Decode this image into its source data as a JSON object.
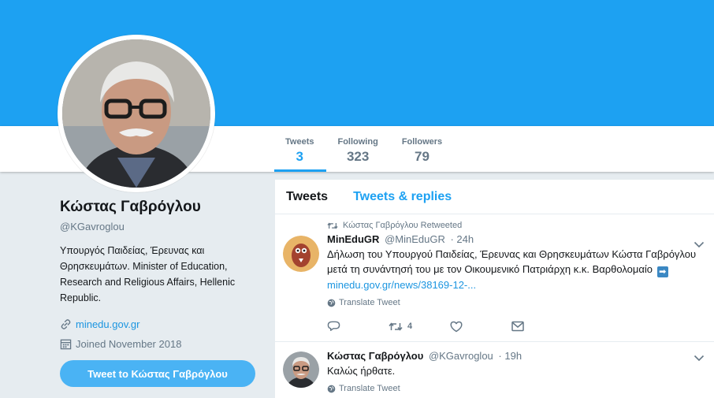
{
  "profile": {
    "name": "Κώστας Γαβρόγλου",
    "handle": "@KGavroglou",
    "bio": "Υπουργός Παιδείας, Έρευνας και Θρησκευμάτων. Minister of Education, Research and Religious Affairs, Hellenic Republic.",
    "website": "minedu.gov.gr",
    "joined": "Joined November 2018",
    "tweet_to_label": "Tweet to Κώστας Γαβρόγλου"
  },
  "stats": [
    {
      "label": "Tweets",
      "value": "3"
    },
    {
      "label": "Following",
      "value": "323"
    },
    {
      "label": "Followers",
      "value": "79"
    }
  ],
  "timeline": {
    "tabs": [
      "Tweets",
      "Tweets & replies"
    ],
    "tweets": [
      {
        "context": "Κώστας Γαβρόγλου Retweeted",
        "name": "MinEduGR",
        "handle": "@MinEduGR",
        "time": "· 24h",
        "text": "Δήλωση του Υπουργού Παιδείας, Έρευνας και Θρησκευμάτων Κώστα Γαβρόγλου μετά τη συνάντησή του με τον Οικουμενικό Πατριάρχη κ.κ. Βαρθολομαίο",
        "arrow": "➡",
        "link": "minedu.gov.gr/news/38169-12-...",
        "translate": "Translate Tweet",
        "retweets": "4"
      },
      {
        "name": "Κώστας Γαβρόγλου",
        "handle": "@KGavroglou",
        "time": "· 19h",
        "text": "Καλώς ήρθατε.",
        "translate": "Translate Tweet"
      }
    ]
  },
  "colors": {
    "brand": "#1da1f2",
    "banner": "#1da1f2",
    "button": "#4ab3f4",
    "link": "#1b95e0"
  },
  "icons": [
    "link-icon",
    "calendar-icon",
    "retweet-icon",
    "globe-icon",
    "reply-icon",
    "like-icon",
    "message-icon",
    "chevron-down-icon"
  ]
}
